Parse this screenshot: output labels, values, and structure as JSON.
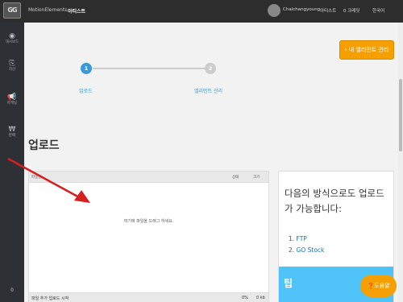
{
  "topbar": {
    "logo": "GG",
    "nav": [
      "MotionElements",
      "아티스트"
    ],
    "user": "Chaichangyoung",
    "artist_menu": "아티스트",
    "credit": "0 크레딧",
    "language": "한국어"
  },
  "sidebar": {
    "items": [
      {
        "label": "대시보드",
        "icon": "dashboard-icon"
      },
      {
        "label": "자산",
        "icon": "asset-icon"
      },
      {
        "label": "마케팅",
        "icon": "megaphone-icon"
      },
      {
        "label": "판매",
        "icon": "won-icon"
      }
    ],
    "count": "0"
  },
  "header": {
    "manage_button": "› 내 엘리먼트 관리"
  },
  "steps": [
    {
      "num": "1",
      "label": "업로드",
      "color": "#3a9ad9"
    },
    {
      "num": "2",
      "label": "엘리먼트 관리",
      "color": "#cccccc"
    }
  ],
  "page_title": "업로드",
  "upload_panel": {
    "columns": [
      "파일명",
      "상태",
      "크기"
    ],
    "drop_text": "여기에 파일을 드래그 하세요.",
    "footer": {
      "text": "파일 추가 업로드 시작",
      "percent": "0%",
      "size": "0 kb"
    }
  },
  "info_panel": {
    "title": "다음의 방식으로도 업로드가 가능합니다:",
    "methods": [
      "FTP",
      "GO Stock"
    ],
    "tip": "팁"
  },
  "help_button": "❓도움말",
  "colors": {
    "accent": "#f5a000",
    "step_active": "#3a9ad9",
    "tip": "#4fc3f7",
    "arrow": "#d61f1f"
  }
}
